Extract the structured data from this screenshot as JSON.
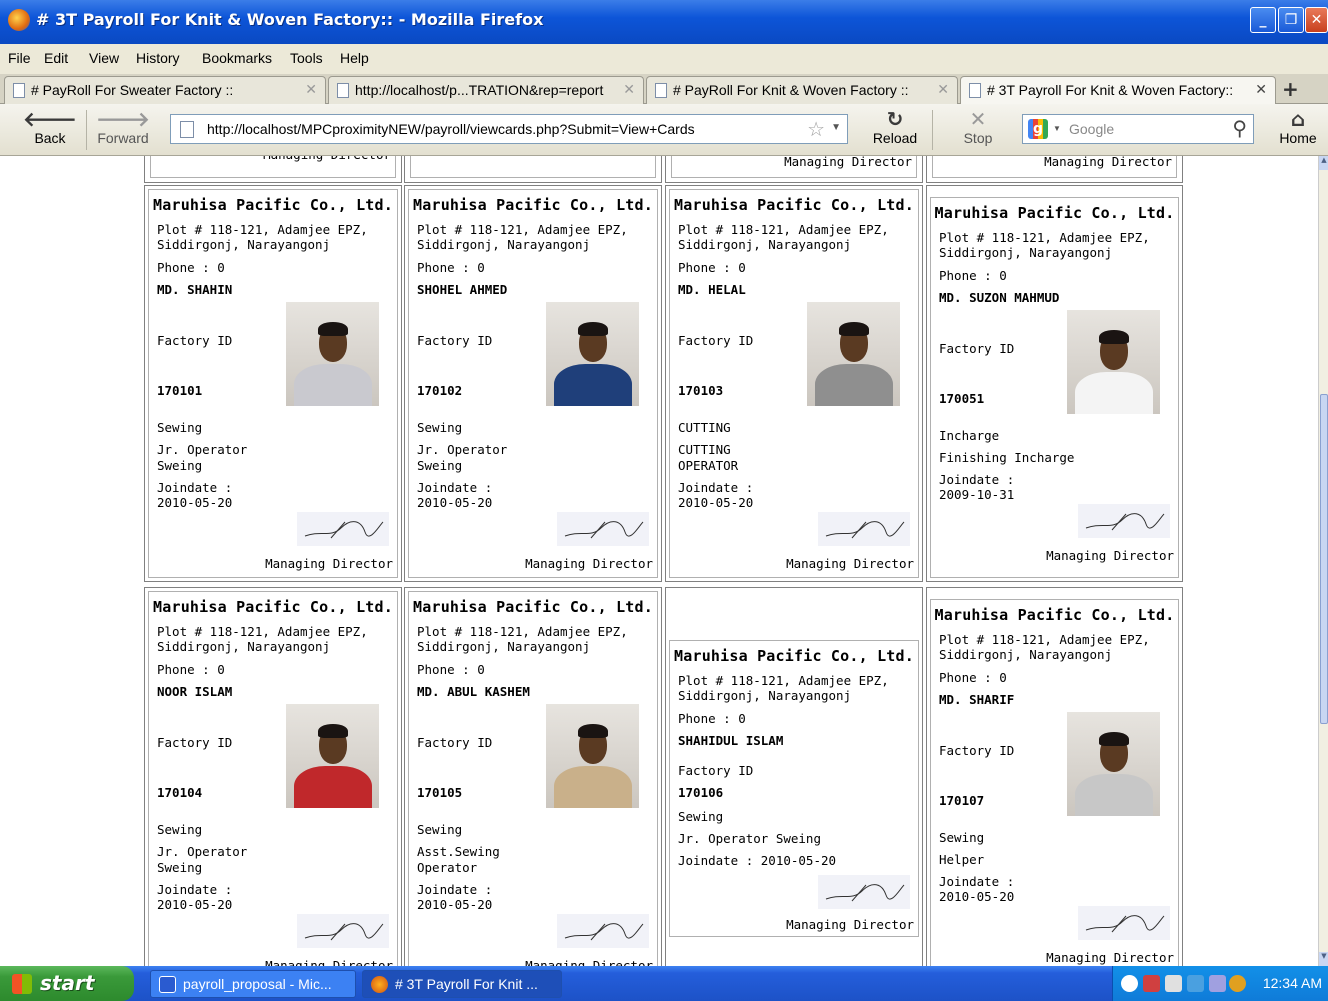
{
  "window": {
    "title": "# 3T Payroll For Knit & Woven Factory:: - Mozilla Firefox"
  },
  "menu": [
    "File",
    "Edit",
    "View",
    "History",
    "Bookmarks",
    "Tools",
    "Help"
  ],
  "tabs": [
    {
      "label": "# PayRoll For Sweater Factory ::"
    },
    {
      "label": "http://localhost/p...TRATION&rep=report"
    },
    {
      "label": "# PayRoll For Knit & Woven Factory ::"
    },
    {
      "label": "# 3T Payroll For Knit & Woven Factory::"
    }
  ],
  "nav": {
    "back": "Back",
    "forward": "Forward",
    "reload": "Reload",
    "stop": "Stop",
    "home": "Home",
    "url": "http://localhost/MPCproximityNEW/payroll/viewcards.php?Submit=View+Cards",
    "search_placeholder": "Google"
  },
  "company": {
    "name": "Maruhisa Pacific Co., Ltd.",
    "addr1": "Plot # 118-121, Adamjee EPZ,",
    "addr2": "Siddirgonj, Narayangonj",
    "phone": "Phone : 0"
  },
  "labels": {
    "factory_id": "Factory ID",
    "joindate": "Joindate :",
    "md": "Managing Director",
    "md_top": "Managing Director"
  },
  "cards": [
    {
      "name": "MD. SHAHIN",
      "id": "170101",
      "dept": "Sewing",
      "desig1": "Jr. Operator",
      "desig2": "Sweing",
      "date": "2010-05-20"
    },
    {
      "name": "SHOHEL AHMED",
      "id": "170102",
      "dept": "Sewing",
      "desig1": "Jr. Operator",
      "desig2": "Sweing",
      "date": "2010-05-20"
    },
    {
      "name": "MD. HELAL",
      "id": "170103",
      "dept": "CUTTING",
      "desig1": "CUTTING",
      "desig2": "OPERATOR",
      "date": "2010-05-20"
    },
    {
      "name": "MD. SUZON MAHMUD",
      "id": "170051",
      "dept": "Incharge",
      "desig1": "Finishing Incharge",
      "desig2": "",
      "date": "2009-10-31"
    },
    {
      "name": "NOOR ISLAM",
      "id": "170104",
      "dept": "Sewing",
      "desig1": "Jr. Operator",
      "desig2": "Sweing",
      "date": "2010-05-20"
    },
    {
      "name": "MD. ABUL KASHEM",
      "id": "170105",
      "dept": "Sewing",
      "desig1": "Asst.Sewing",
      "desig2": "Operator",
      "date": "2010-05-20"
    },
    {
      "name": "SHAHIDUL ISLAM",
      "id": "170106",
      "dept": "Sewing",
      "desig1": "Jr. Operator Sweing",
      "desig2": "",
      "date": "2010-05-20",
      "joindate_inline": "Joindate : 2010-05-20"
    },
    {
      "name": "MD. SHARIF",
      "id": "170107",
      "dept": "Sewing",
      "desig1": "Helper",
      "desig2": "",
      "date": "2010-05-20"
    }
  ],
  "photo_colors": [
    "#c9c9cf",
    "#1f3f7a",
    "#8f8f8f",
    "#f4f4f4",
    "#c0282b",
    "#c9b08a",
    "#c7c7c7"
  ],
  "taskbar": {
    "start": "start",
    "items": [
      "payroll_proposal - Mic...",
      "# 3T Payroll For Knit ..."
    ],
    "clock": "12:34 AM"
  }
}
